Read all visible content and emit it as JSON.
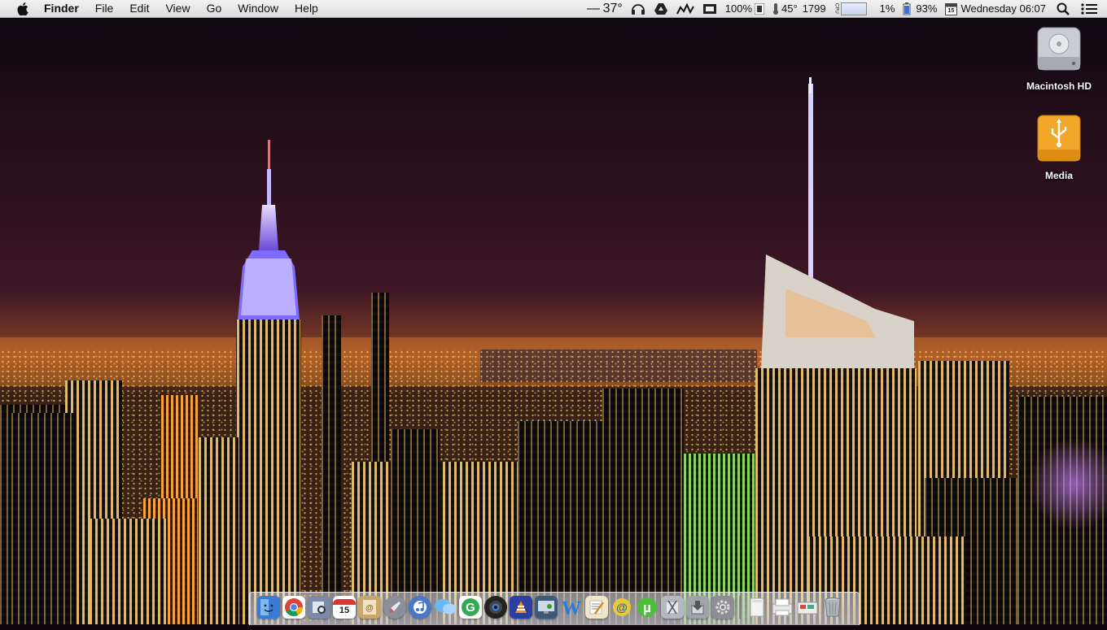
{
  "menubar": {
    "apple_icon": "apple-logo-icon",
    "app_name": "Finder",
    "menus": [
      "File",
      "Edit",
      "View",
      "Go",
      "Window",
      "Help"
    ],
    "status": {
      "temperature": "37°",
      "volume_percent": "100%",
      "fan_temp": "45°",
      "fan_rpm": "1799",
      "cpu_label": "CPU",
      "cpu_percent": "1%",
      "battery_percent": "93%",
      "calendar_day": "15",
      "clock": "Wednesday 06:07"
    }
  },
  "desktop": {
    "icons": [
      {
        "label": "Macintosh HD",
        "icon": "hard-drive-icon"
      },
      {
        "label": "Media",
        "icon": "usb-drive-icon"
      }
    ]
  },
  "dock": {
    "calendar_day": "15",
    "apps": [
      {
        "name": "finder",
        "icon": "finder-icon",
        "color": "#3a7bd5"
      },
      {
        "name": "chrome",
        "icon": "chrome-icon",
        "color": "#db4437"
      },
      {
        "name": "preview",
        "icon": "preview-icon",
        "color": "#7a8aa8"
      },
      {
        "name": "calendar",
        "icon": "calendar-icon",
        "color": "#ffffff"
      },
      {
        "name": "contacts",
        "icon": "contacts-icon",
        "color": "#c9a66b"
      },
      {
        "name": "launchpad",
        "icon": "rocket-icon",
        "color": "#8a8f99"
      },
      {
        "name": "itunes",
        "icon": "itunes-icon",
        "color": "#4a78c8"
      },
      {
        "name": "messages",
        "icon": "messages-icon",
        "color": "#5aa9f0"
      },
      {
        "name": "google",
        "icon": "google-icon",
        "color": "#34a853"
      },
      {
        "name": "photo-booth",
        "icon": "camera-icon",
        "color": "#222222"
      },
      {
        "name": "vlc",
        "icon": "cone-icon",
        "color": "#2a3fa0"
      },
      {
        "name": "remote-desktop",
        "icon": "remote-desktop-icon",
        "color": "#3d5a7a"
      },
      {
        "name": "word",
        "icon": "word-icon",
        "color": "#2b6cc4"
      },
      {
        "name": "textedit",
        "icon": "textedit-icon",
        "color": "#f1e7c8"
      },
      {
        "name": "ftp-client",
        "icon": "ftp-icon",
        "color": "#e8c93a"
      },
      {
        "name": "utorrent",
        "icon": "utorrent-icon",
        "color": "#4bbf3a"
      },
      {
        "name": "automator",
        "icon": "automator-icon",
        "color": "#b4b8bf"
      },
      {
        "name": "installer",
        "icon": "installer-icon",
        "color": "#9fa4ab"
      },
      {
        "name": "system-preferences",
        "icon": "gear-icon",
        "color": "#8d8f94"
      }
    ],
    "stacks": [
      {
        "name": "documents",
        "icon": "document-stack-icon",
        "color": "#f4f4f4"
      },
      {
        "name": "downloads",
        "icon": "printer-icon",
        "color": "#e8e8e8"
      },
      {
        "name": "applications",
        "icon": "folder-stack-icon",
        "color": "#eeeeee"
      },
      {
        "name": "trash",
        "icon": "trash-icon",
        "color": "#9aa0a8"
      }
    ]
  }
}
